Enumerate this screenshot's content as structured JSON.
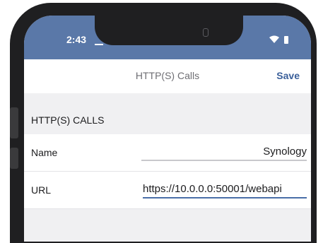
{
  "status_bar": {
    "time": "2:43",
    "wifi_icon": "wifi-icon",
    "battery_icon": "battery-icon"
  },
  "nav": {
    "title": "HTTP(S) Calls",
    "save_label": "Save"
  },
  "section": {
    "title": "HTTP(S) CALLS"
  },
  "form": {
    "name": {
      "label": "Name",
      "value": "Synology"
    },
    "url": {
      "label": "URL",
      "value": "https://10.0.0.0:50001/webapi"
    }
  },
  "colors": {
    "status_bar": "#5a78a8",
    "accent": "#3a5f9a",
    "active_underline": "#4a6ea8"
  }
}
